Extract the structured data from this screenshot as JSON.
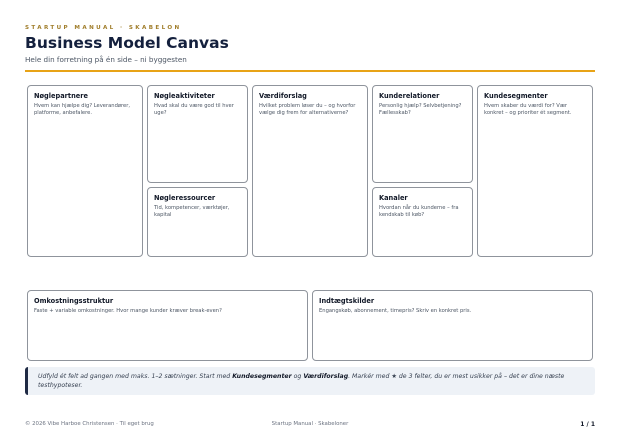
{
  "header": {
    "eyebrow": "STARTUP MANUAL · SKABELON",
    "title": "Business Model Canvas",
    "subtitle": "Hele din forretning på én side – ni byggesten"
  },
  "canvas": {
    "partners": {
      "title": "Nøglepartnere",
      "hint": "Hvem kan hjælpe dig? Leverandører, platforme, anbefalere."
    },
    "activities": {
      "title": "Nøgleaktiviteter",
      "hint": "Hvad skal du være god til hver uge?"
    },
    "resources": {
      "title": "Nøgleressourcer",
      "hint": "Tid, kompetencer, værktøjer, kapital"
    },
    "value": {
      "title": "Værdiforslag",
      "hint": "Hvilket problem løser du – og hvorfor vælge dig frem for alternativerne?"
    },
    "relations": {
      "title": "Kunderelationer",
      "hint": "Personlig hjælp? Selvbetjening? Fællesskab?"
    },
    "channels": {
      "title": "Kanaler",
      "hint": "Hvordan når du kunderne – fra kendskab til køb?"
    },
    "segments": {
      "title": "Kundesegmenter",
      "hint": "Hvem skaber du værdi for? Vær konkret – og prioriter ét segment."
    },
    "costs": {
      "title": "Omkostningsstruktur",
      "hint": "Faste + variable omkostninger. Hvor mange kunder kræver break-even?"
    },
    "revenue": {
      "title": "Indtægtskilder",
      "hint": "Engangskøb, abonnement, timepris? Skriv en konkret pris."
    }
  },
  "note": {
    "part1": "Udfyld ét felt ad gangen med maks. 1–2 sætninger. Start med ",
    "bold1": "Kundesegmenter",
    "part2": " og ",
    "bold2": "Værdiforslag",
    "part3": ". Markér med ★ de 3 felter, du er mest usikker på – det er dine næste testhypoteser."
  },
  "footer": {
    "left": "© 2026 Vibe Harboe Christensen · Til eget brug",
    "center": "Startup Manual · Skabeloner",
    "right": "1 / 1"
  }
}
